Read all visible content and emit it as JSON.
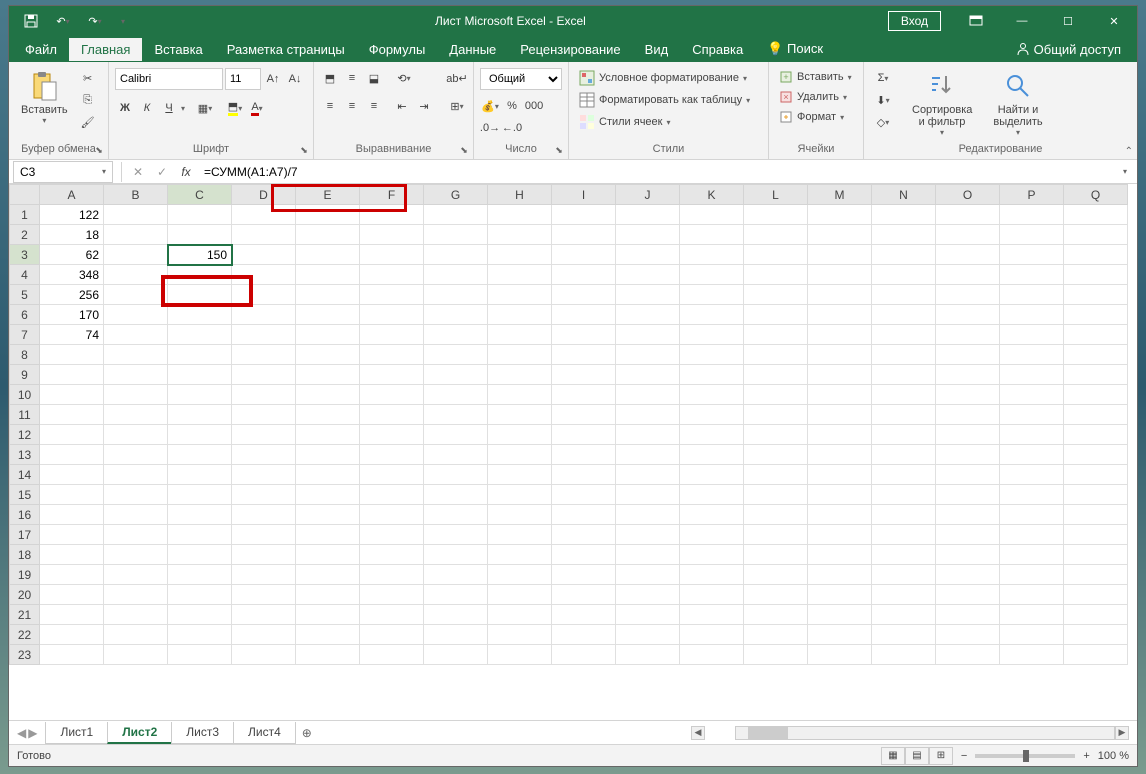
{
  "titlebar": {
    "title": "Лист Microsoft Excel - Excel",
    "login": "Вход"
  },
  "menu": {
    "file": "Файл",
    "home": "Главная",
    "insert": "Вставка",
    "page_layout": "Разметка страницы",
    "formulas": "Формулы",
    "data": "Данные",
    "review": "Рецензирование",
    "view": "Вид",
    "help": "Справка",
    "search": "Поиск",
    "share": "Общий доступ"
  },
  "ribbon": {
    "clipboard": {
      "paste": "Вставить",
      "label": "Буфер обмена"
    },
    "font": {
      "name": "Calibri",
      "size": "11",
      "bold": "Ж",
      "italic": "К",
      "underline": "Ч",
      "label": "Шрифт"
    },
    "alignment": {
      "label": "Выравнивание"
    },
    "number": {
      "format": "Общий",
      "label": "Число"
    },
    "styles": {
      "conditional": "Условное форматирование",
      "as_table": "Форматировать как таблицу",
      "cell_styles": "Стили ячеек",
      "label": "Стили"
    },
    "cells": {
      "insert": "Вставить",
      "delete": "Удалить",
      "format": "Формат",
      "label": "Ячейки"
    },
    "editing": {
      "sort": "Сортировка и фильтр",
      "find": "Найти и выделить",
      "label": "Редактирование"
    }
  },
  "formula_bar": {
    "cell_ref": "C3",
    "formula": "=СУММ(A1:A7)/7"
  },
  "grid": {
    "columns": [
      "A",
      "B",
      "C",
      "D",
      "E",
      "F",
      "G",
      "H",
      "I",
      "J",
      "K",
      "L",
      "M",
      "N",
      "O",
      "P",
      "Q"
    ],
    "rows": [
      1,
      2,
      3,
      4,
      5,
      6,
      7,
      8,
      9,
      10,
      11,
      12,
      13,
      14,
      15,
      16,
      17,
      18,
      19,
      20,
      21,
      22,
      23
    ],
    "data_A": [
      "122",
      "18",
      "62",
      "348",
      "256",
      "170",
      "74"
    ],
    "c3_value": "150",
    "active_col": "C",
    "active_row": 3
  },
  "sheets": {
    "tabs": [
      "Лист1",
      "Лист2",
      "Лист3",
      "Лист4"
    ],
    "active": 1
  },
  "status": {
    "ready": "Готово",
    "zoom": "100 %"
  }
}
